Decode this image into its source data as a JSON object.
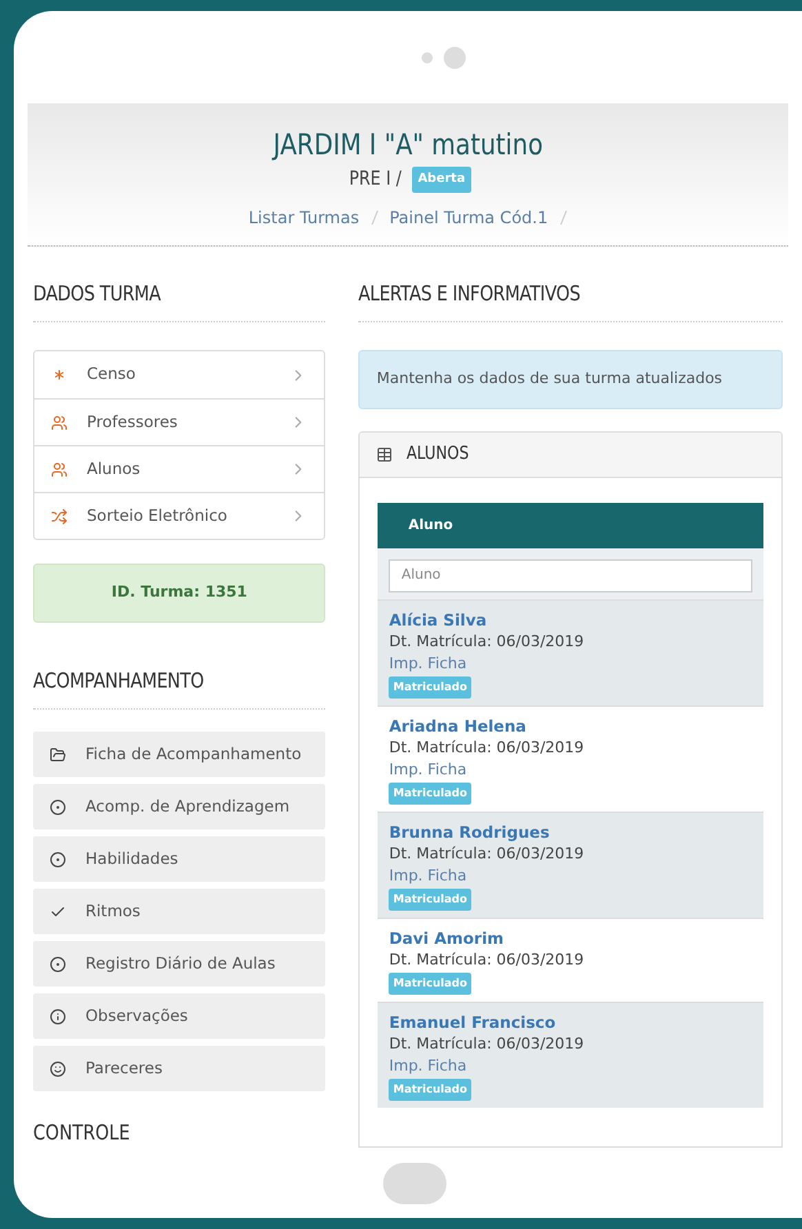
{
  "header": {
    "title": "JARDIM I \"A\" matutino",
    "subtitle": "PRE I /",
    "status_badge": "Aberta",
    "breadcrumbs": [
      "Listar Turmas",
      "Painel Turma Cód.1"
    ]
  },
  "dados_turma": {
    "heading": "DADOS TURMA",
    "items": [
      {
        "label": "Censo",
        "kind": "asterisk"
      },
      {
        "label": "Professores",
        "kind": "users"
      },
      {
        "label": "Alunos",
        "kind": "users"
      },
      {
        "label": "Sorteio Eletrônico",
        "kind": "shuffle"
      }
    ],
    "id_box": "ID. Turma: 1351"
  },
  "acompanhamento": {
    "heading": "ACOMPANHAMENTO",
    "items": [
      {
        "label": "Ficha de Acompanhamento",
        "kind": "folder"
      },
      {
        "label": "Acomp. de Aprendizagem",
        "kind": "dot"
      },
      {
        "label": "Habilidades",
        "kind": "dot"
      },
      {
        "label": "Ritmos",
        "kind": "check"
      },
      {
        "label": "Registro Diário de Aulas",
        "kind": "dot"
      },
      {
        "label": "Observações",
        "kind": "info"
      },
      {
        "label": "Pareceres",
        "kind": "smile"
      }
    ]
  },
  "controle": {
    "heading": "CONTROLE"
  },
  "alertas": {
    "heading": "ALERTAS E INFORMATIVOS",
    "message": "Mantenha os dados de sua turma atualizados"
  },
  "alunos_panel": {
    "title": "ALUNOS",
    "column": "Aluno",
    "filter_placeholder": "Aluno",
    "rows": [
      {
        "name": "Alícia Silva",
        "date": "Dt. Matrícula: 06/03/2019",
        "link": "Imp. Ficha",
        "badge": "Matriculado"
      },
      {
        "name": "Ariadna Helena",
        "date": "Dt. Matrícula: 06/03/2019",
        "link": "Imp. Ficha",
        "badge": "Matriculado"
      },
      {
        "name": "Brunna Rodrigues",
        "date": "Dt. Matrícula: 06/03/2019",
        "link": "Imp. Ficha",
        "badge": "Matriculado"
      },
      {
        "name": "Davi Amorim",
        "date": "Dt. Matrícula: 06/03/2019",
        "badge": "Matriculado"
      },
      {
        "name": "Emanuel Francisco",
        "date": "Dt. Matrícula: 06/03/2019",
        "link": "Imp. Ficha",
        "badge": "Matriculado"
      }
    ]
  }
}
